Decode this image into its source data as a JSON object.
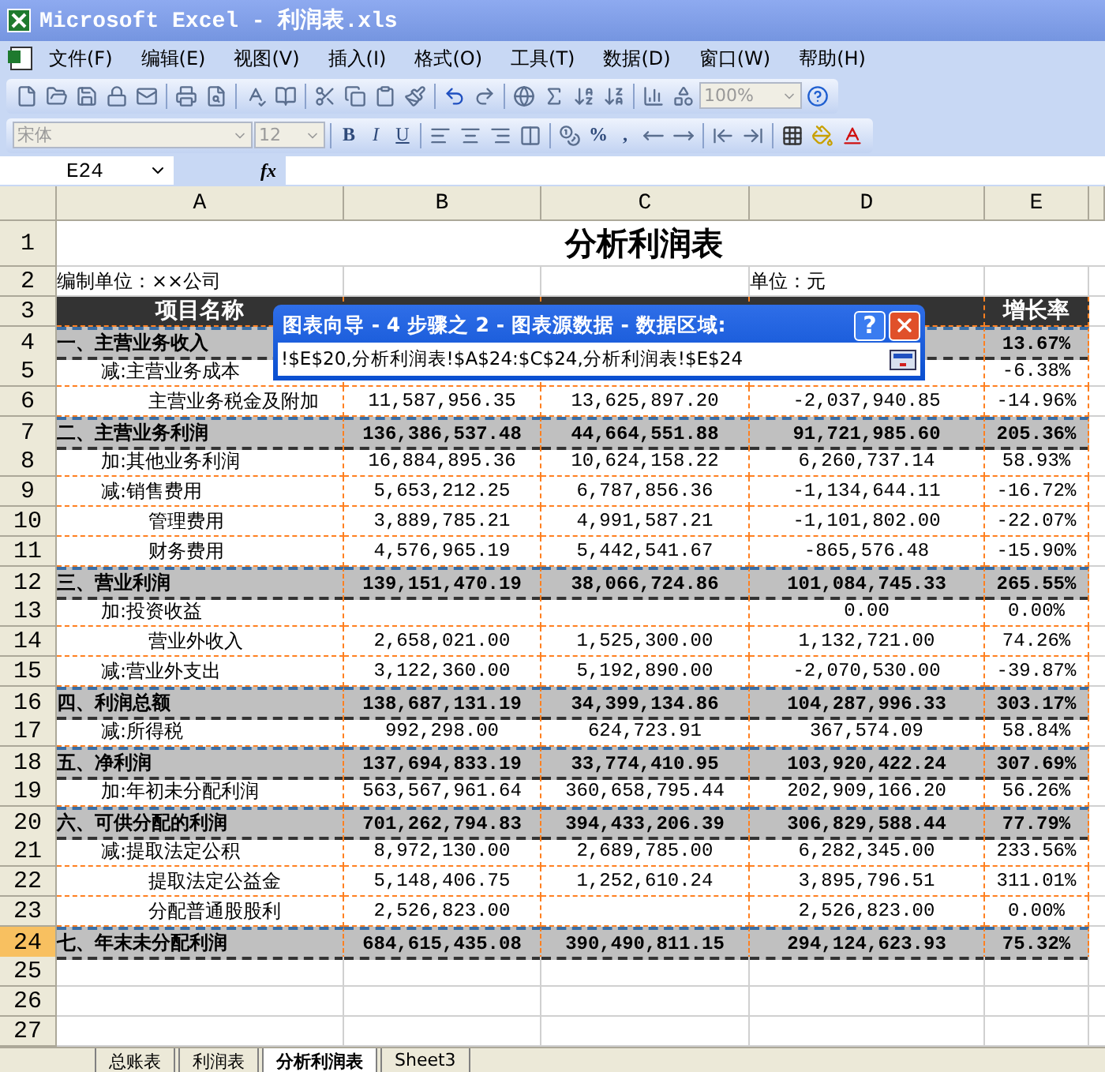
{
  "window": {
    "title": "Microsoft Excel - 利润表.xls"
  },
  "menu": [
    "文件(F)",
    "编辑(E)",
    "视图(V)",
    "插入(I)",
    "格式(O)",
    "工具(T)",
    "数据(D)",
    "窗口(W)",
    "帮助(H)"
  ],
  "standard_toolbar": {
    "zoom": "100%"
  },
  "format_toolbar": {
    "font": "宋体",
    "size": "12",
    "style_buttons": [
      "B",
      "I",
      "U"
    ],
    "number_buttons": [
      "%",
      ","
    ]
  },
  "formula_bar": {
    "name_box": "E24",
    "function_label": "fx"
  },
  "columns": [
    "A",
    "B",
    "C",
    "D",
    "E"
  ],
  "sheet_title": "分析利润表",
  "rows": [
    {
      "num": "1",
      "kind": "title",
      "selected": false
    },
    {
      "num": "2",
      "kind": "info",
      "selected": false,
      "cells": {
        "A": "编制单位：××公司",
        "D": "单位：元"
      }
    },
    {
      "num": "3",
      "kind": "header",
      "selected": false,
      "cells": {
        "A": "项目名称",
        "E": "增长率"
      }
    },
    {
      "num": "4",
      "kind": "total",
      "selected": false,
      "cells": {
        "A": "一、主营业务收入",
        "E": "13.67%"
      }
    },
    {
      "num": "5",
      "kind": "item",
      "selected": false,
      "cells": {
        "A": "减:主营业务成本",
        "E": "-6.38%"
      }
    },
    {
      "num": "6",
      "kind": "subitem",
      "selected": false,
      "cells": {
        "A": "主营业务税金及附加",
        "B": "11,587,956.35",
        "C": "13,625,897.20",
        "D": "-2,037,940.85",
        "E": "-14.96%"
      }
    },
    {
      "num": "7",
      "kind": "total",
      "selected": false,
      "cells": {
        "A": "二、主营业务利润",
        "B": "136,386,537.48",
        "C": "44,664,551.88",
        "D": "91,721,985.60",
        "E": "205.36%"
      }
    },
    {
      "num": "8",
      "kind": "item",
      "selected": false,
      "cells": {
        "A": "加:其他业务利润",
        "B": "16,884,895.36",
        "C": "10,624,158.22",
        "D": "6,260,737.14",
        "E": "58.93%"
      }
    },
    {
      "num": "9",
      "kind": "item",
      "selected": false,
      "cells": {
        "A": "减:销售费用",
        "B": "5,653,212.25",
        "C": "6,787,856.36",
        "D": "-1,134,644.11",
        "E": "-16.72%"
      }
    },
    {
      "num": "10",
      "kind": "subitem",
      "selected": false,
      "cells": {
        "A": "管理费用",
        "B": "3,889,785.21",
        "C": "4,991,587.21",
        "D": "-1,101,802.00",
        "E": "-22.07%"
      }
    },
    {
      "num": "11",
      "kind": "subitem",
      "selected": false,
      "cells": {
        "A": "财务费用",
        "B": "4,576,965.19",
        "C": "5,442,541.67",
        "D": "-865,576.48",
        "E": "-15.90%"
      }
    },
    {
      "num": "12",
      "kind": "total",
      "selected": false,
      "cells": {
        "A": "三、营业利润",
        "B": "139,151,470.19",
        "C": "38,066,724.86",
        "D": "101,084,745.33",
        "E": "265.55%"
      }
    },
    {
      "num": "13",
      "kind": "item",
      "selected": false,
      "cells": {
        "A": "加:投资收益",
        "D": "0.00",
        "E": "0.00%"
      }
    },
    {
      "num": "14",
      "kind": "subitem",
      "selected": false,
      "cells": {
        "A": "营业外收入",
        "B": "2,658,021.00",
        "C": "1,525,300.00",
        "D": "1,132,721.00",
        "E": "74.26%"
      }
    },
    {
      "num": "15",
      "kind": "item",
      "selected": false,
      "cells": {
        "A": "减:营业外支出",
        "B": "3,122,360.00",
        "C": "5,192,890.00",
        "D": "-2,070,530.00",
        "E": "-39.87%"
      }
    },
    {
      "num": "16",
      "kind": "total",
      "selected": false,
      "cells": {
        "A": "四、利润总额",
        "B": "138,687,131.19",
        "C": "34,399,134.86",
        "D": "104,287,996.33",
        "E": "303.17%"
      }
    },
    {
      "num": "17",
      "kind": "item",
      "selected": false,
      "cells": {
        "A": "减:所得税",
        "B": "992,298.00",
        "C": "624,723.91",
        "D": "367,574.09",
        "E": "58.84%"
      }
    },
    {
      "num": "18",
      "kind": "total",
      "selected": false,
      "cells": {
        "A": "五、净利润",
        "B": "137,694,833.19",
        "C": "33,774,410.95",
        "D": "103,920,422.24",
        "E": "307.69%"
      }
    },
    {
      "num": "19",
      "kind": "item",
      "selected": false,
      "cells": {
        "A": "加:年初未分配利润",
        "B": "563,567,961.64",
        "C": "360,658,795.44",
        "D": "202,909,166.20",
        "E": "56.26%"
      }
    },
    {
      "num": "20",
      "kind": "total",
      "selected": false,
      "cells": {
        "A": "六、可供分配的利润",
        "B": "701,262,794.83",
        "C": "394,433,206.39",
        "D": "306,829,588.44",
        "E": "77.79%"
      }
    },
    {
      "num": "21",
      "kind": "item",
      "selected": false,
      "cells": {
        "A": "减:提取法定公积",
        "B": "8,972,130.00",
        "C": "2,689,785.00",
        "D": "6,282,345.00",
        "E": "233.56%"
      }
    },
    {
      "num": "22",
      "kind": "subitem",
      "selected": false,
      "cells": {
        "A": "提取法定公益金",
        "B": "5,148,406.75",
        "C": "1,252,610.24",
        "D": "3,895,796.51",
        "E": "311.01%"
      }
    },
    {
      "num": "23",
      "kind": "subitem",
      "selected": false,
      "cells": {
        "A": "分配普通股股利",
        "B": "2,526,823.00",
        "D": "2,526,823.00",
        "E": "0.00%"
      }
    },
    {
      "num": "24",
      "kind": "total",
      "selected": true,
      "cells": {
        "A": "七、年末未分配利润",
        "B": "684,615,435.08",
        "C": "390,490,811.15",
        "D": "294,124,623.93",
        "E": "75.32%"
      }
    },
    {
      "num": "25",
      "kind": "empty",
      "selected": false
    },
    {
      "num": "26",
      "kind": "empty",
      "selected": false
    },
    {
      "num": "27",
      "kind": "empty",
      "selected": false
    }
  ],
  "dialog": {
    "title": "图表向导 - 4 步骤之 2 - 图表源数据 - 数据区域:",
    "help": "?",
    "range": "!$E$20,分析利润表!$A$24:$C$24,分析利润表!$E$24"
  },
  "sheet_tabs": [
    {
      "label": "总账表",
      "selected": false
    },
    {
      "label": "利润表",
      "selected": false
    },
    {
      "label": "分析利润表",
      "selected": true
    },
    {
      "label": "Sheet3",
      "selected": false
    }
  ]
}
